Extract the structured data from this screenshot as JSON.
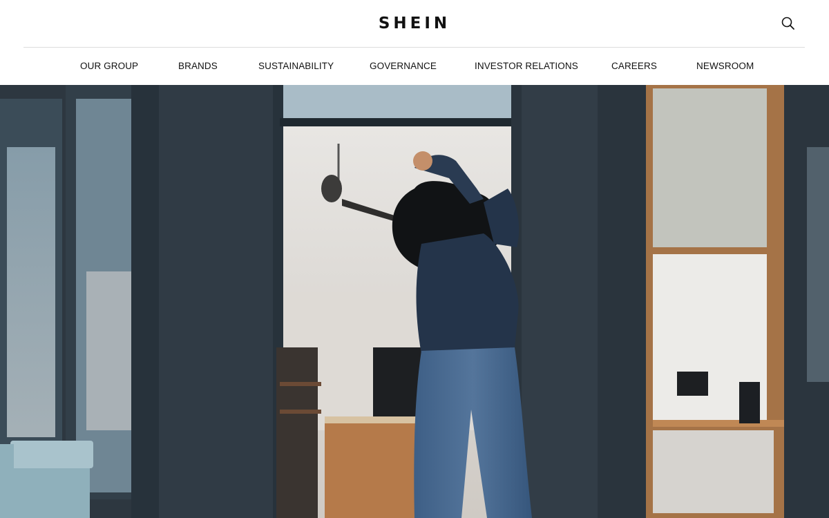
{
  "header": {
    "logo_text": "SHEIN",
    "search_icon": "search-icon"
  },
  "nav": {
    "items": [
      {
        "label": "OUR GROUP"
      },
      {
        "label": "BRANDS"
      },
      {
        "label": "SUSTAINABILITY"
      },
      {
        "label": "GOVERNANCE"
      },
      {
        "label": "INVESTOR RELATIONS"
      },
      {
        "label": "CAREERS"
      },
      {
        "label": "NEWSROOM"
      }
    ]
  },
  "colors": {
    "text": "#111111",
    "divider": "#dcdcdc",
    "background": "#ffffff"
  }
}
